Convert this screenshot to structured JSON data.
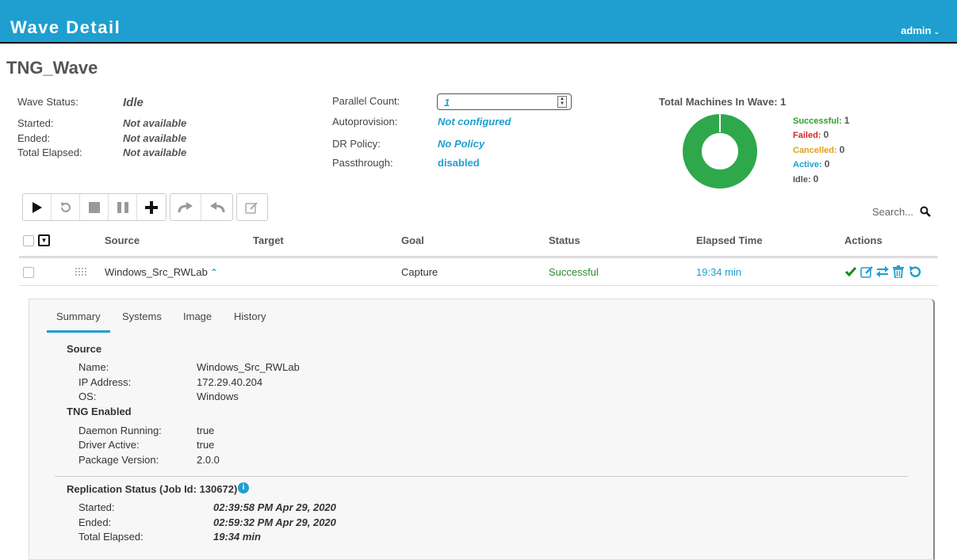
{
  "header": {
    "title": "Wave Detail",
    "user": "admin"
  },
  "wave": {
    "name": "TNG_Wave"
  },
  "info": {
    "wave_status_label": "Wave Status:",
    "wave_status": "Idle",
    "started_label": "Started:",
    "started": "Not available",
    "ended_label": "Ended:",
    "ended": "Not available",
    "elapsed_label": "Total Elapsed:",
    "elapsed": "Not available",
    "parallel_label": "Parallel Count:",
    "parallel": "1",
    "autoprov_label": "Autoprovision:",
    "autoprov": "Not configured",
    "dr_label": "DR Policy:",
    "dr": "No Policy",
    "pass_label": "Passthrough:",
    "pass": "disabled"
  },
  "summary_chart": {
    "title": "Total Machines In Wave: 1",
    "legend": [
      {
        "label": "Successful:",
        "count": "1",
        "color": "#2ca02c"
      },
      {
        "label": "Failed:",
        "count": "0",
        "color": "#d62728"
      },
      {
        "label": "Cancelled:",
        "count": "0",
        "color": "#e0a020"
      },
      {
        "label": "Active:",
        "count": "0",
        "color": "#1e9fcf"
      },
      {
        "label": "Idle:",
        "count": "0",
        "color": "#555555"
      }
    ],
    "successful_fraction": 1.0,
    "ring_color": "#2ea84a"
  },
  "toolbar": {
    "icons": [
      "play-icon",
      "reset-icon",
      "stop-icon",
      "pause-icon",
      "add-icon",
      "redo-icon",
      "undo-icon",
      "edit-icon"
    ]
  },
  "search": {
    "placeholder": "Search..."
  },
  "table": {
    "columns": [
      "Source",
      "Target",
      "Goal",
      "Status",
      "Elapsed Time",
      "Actions"
    ],
    "rows": [
      {
        "source": "Windows_Src_RWLab",
        "target": "",
        "goal": "Capture",
        "status": "Successful",
        "elapsed": "19:34 min"
      }
    ]
  },
  "detail": {
    "tabs": [
      "Summary",
      "Systems",
      "Image",
      "History"
    ],
    "source_title": "Source",
    "name_label": "Name:",
    "name": "Windows_Src_RWLab",
    "ip_label": "IP Address:",
    "ip": "172.29.40.204",
    "os_label": "OS:",
    "os": "Windows",
    "tng_title": "TNG Enabled",
    "daemon_label": "Daemon Running:",
    "daemon": "true",
    "driver_label": "Driver Active:",
    "driver": "true",
    "pkg_label": "Package Version:",
    "pkg": "2.0.0",
    "repl_title": "Replication Status (Job Id: 130672)",
    "r_started_label": "Started:",
    "r_started": "02:39:58 PM Apr 29, 2020",
    "r_ended_label": "Ended:",
    "r_ended": "02:59:32 PM Apr 29, 2020",
    "r_elapsed_label": "Total Elapsed:",
    "r_elapsed": "19:34 min"
  }
}
